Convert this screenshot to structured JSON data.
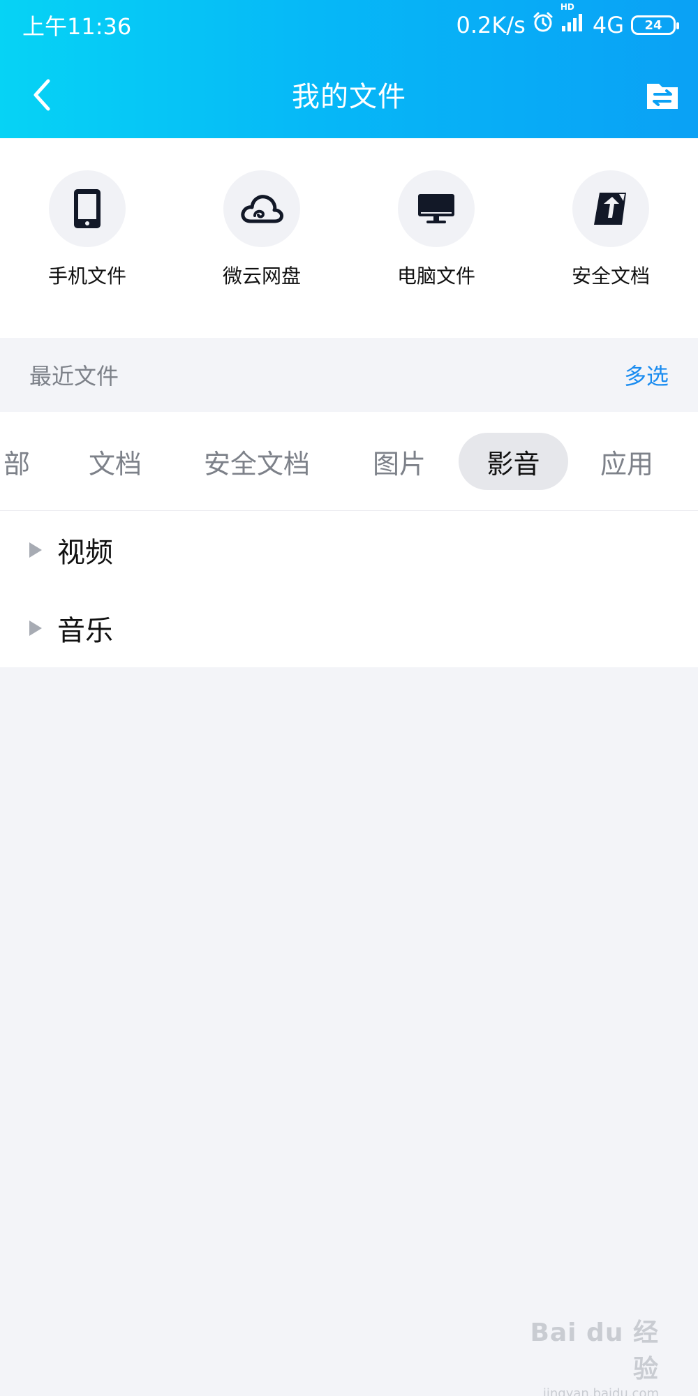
{
  "status_bar": {
    "time": "上午11:36",
    "network_speed": "0.2K/s",
    "hd": "HD",
    "network_type": "4G",
    "battery": "24"
  },
  "header": {
    "title": "我的文件"
  },
  "quick_access": [
    {
      "label": "手机文件",
      "icon": "phone-icon"
    },
    {
      "label": "微云网盘",
      "icon": "cloud-icon"
    },
    {
      "label": "电脑文件",
      "icon": "computer-icon"
    },
    {
      "label": "安全文档",
      "icon": "secure-doc-icon"
    }
  ],
  "recent": {
    "title": "最近文件",
    "multi_select": "多选"
  },
  "tabs": [
    {
      "label": "部"
    },
    {
      "label": "文档"
    },
    {
      "label": "安全文档"
    },
    {
      "label": "图片"
    },
    {
      "label": "影音",
      "active": true
    },
    {
      "label": "应用"
    }
  ],
  "categories": [
    {
      "label": "视频"
    },
    {
      "label": "音乐"
    }
  ],
  "watermark": {
    "main": "Bai du 经验",
    "sub": "jingyan.baidu.com"
  },
  "colors": {
    "header_start": "#06d3f5",
    "header_end": "#0aa1f5",
    "accent_link": "#1a8cf0",
    "page_bg": "#f3f4f8"
  }
}
